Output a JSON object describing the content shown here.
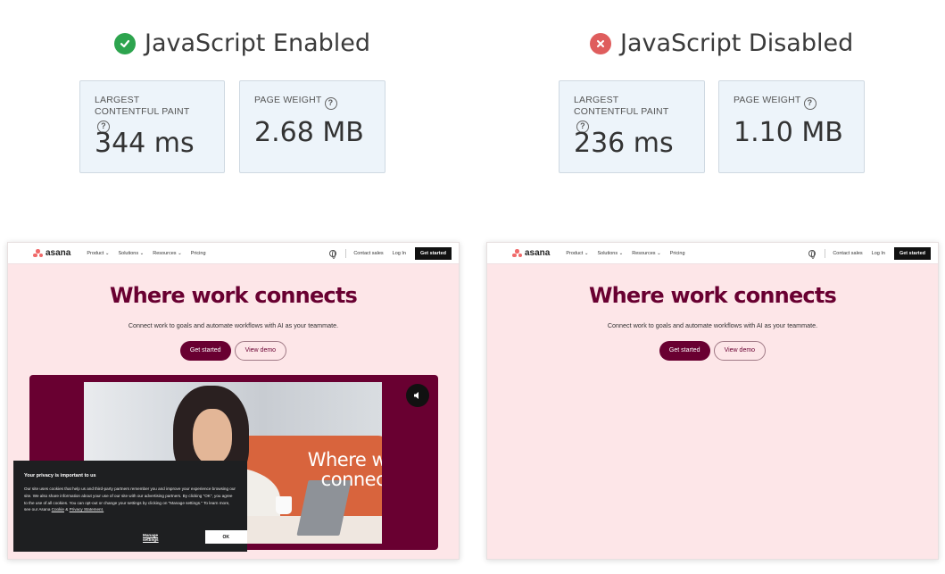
{
  "colors": {
    "enabled_icon": "#2da44e",
    "disabled_icon": "#df5d5d",
    "brand": "#690031",
    "hero_bg": "#fde6e8",
    "metric_bg": "#edf4fa"
  },
  "enabled": {
    "title": "JavaScript Enabled",
    "status_icon": "check-circle-icon",
    "metrics": [
      {
        "label": "LARGEST CONTENTFUL PAINT",
        "value": "344 ms"
      },
      {
        "label": "PAGE WEIGHT",
        "value": "2.68 MB"
      }
    ]
  },
  "disabled": {
    "title": "JavaScript Disabled",
    "status_icon": "x-circle-icon",
    "metrics": [
      {
        "label": "LARGEST CONTENTFUL PAINT",
        "value": "236 ms"
      },
      {
        "label": "PAGE WEIGHT",
        "value": "1.10 MB"
      }
    ]
  },
  "site": {
    "logo": "asana",
    "nav": [
      "Product",
      "Solutions",
      "Resources",
      "Pricing"
    ],
    "contact": "Contact sales",
    "login": "Log In",
    "get_started_nav": "Get started",
    "hero_title": "Where work connects",
    "hero_sub": "Connect work to goals and automate workflows with AI as your teammate.",
    "cta_primary": "Get started",
    "cta_secondary": "View demo",
    "video_text": "Where work connects",
    "cookie": {
      "title": "Your privacy is important to us",
      "body": "Our site uses cookies that help us and third-party partners remember you and improve your experience browsing our site. We also share information about your use of our site with our advertising partners. By clicking \"OK\", you agree to the use of all cookies. You can opt-out or change your settings by clicking on \"Manage settings.\" To learn more, see our Asana",
      "link_cookie": "Cookie",
      "amp": "&",
      "link_privacy": "Privacy Statement.",
      "manage": "Manage settings",
      "ok": "OK"
    }
  }
}
